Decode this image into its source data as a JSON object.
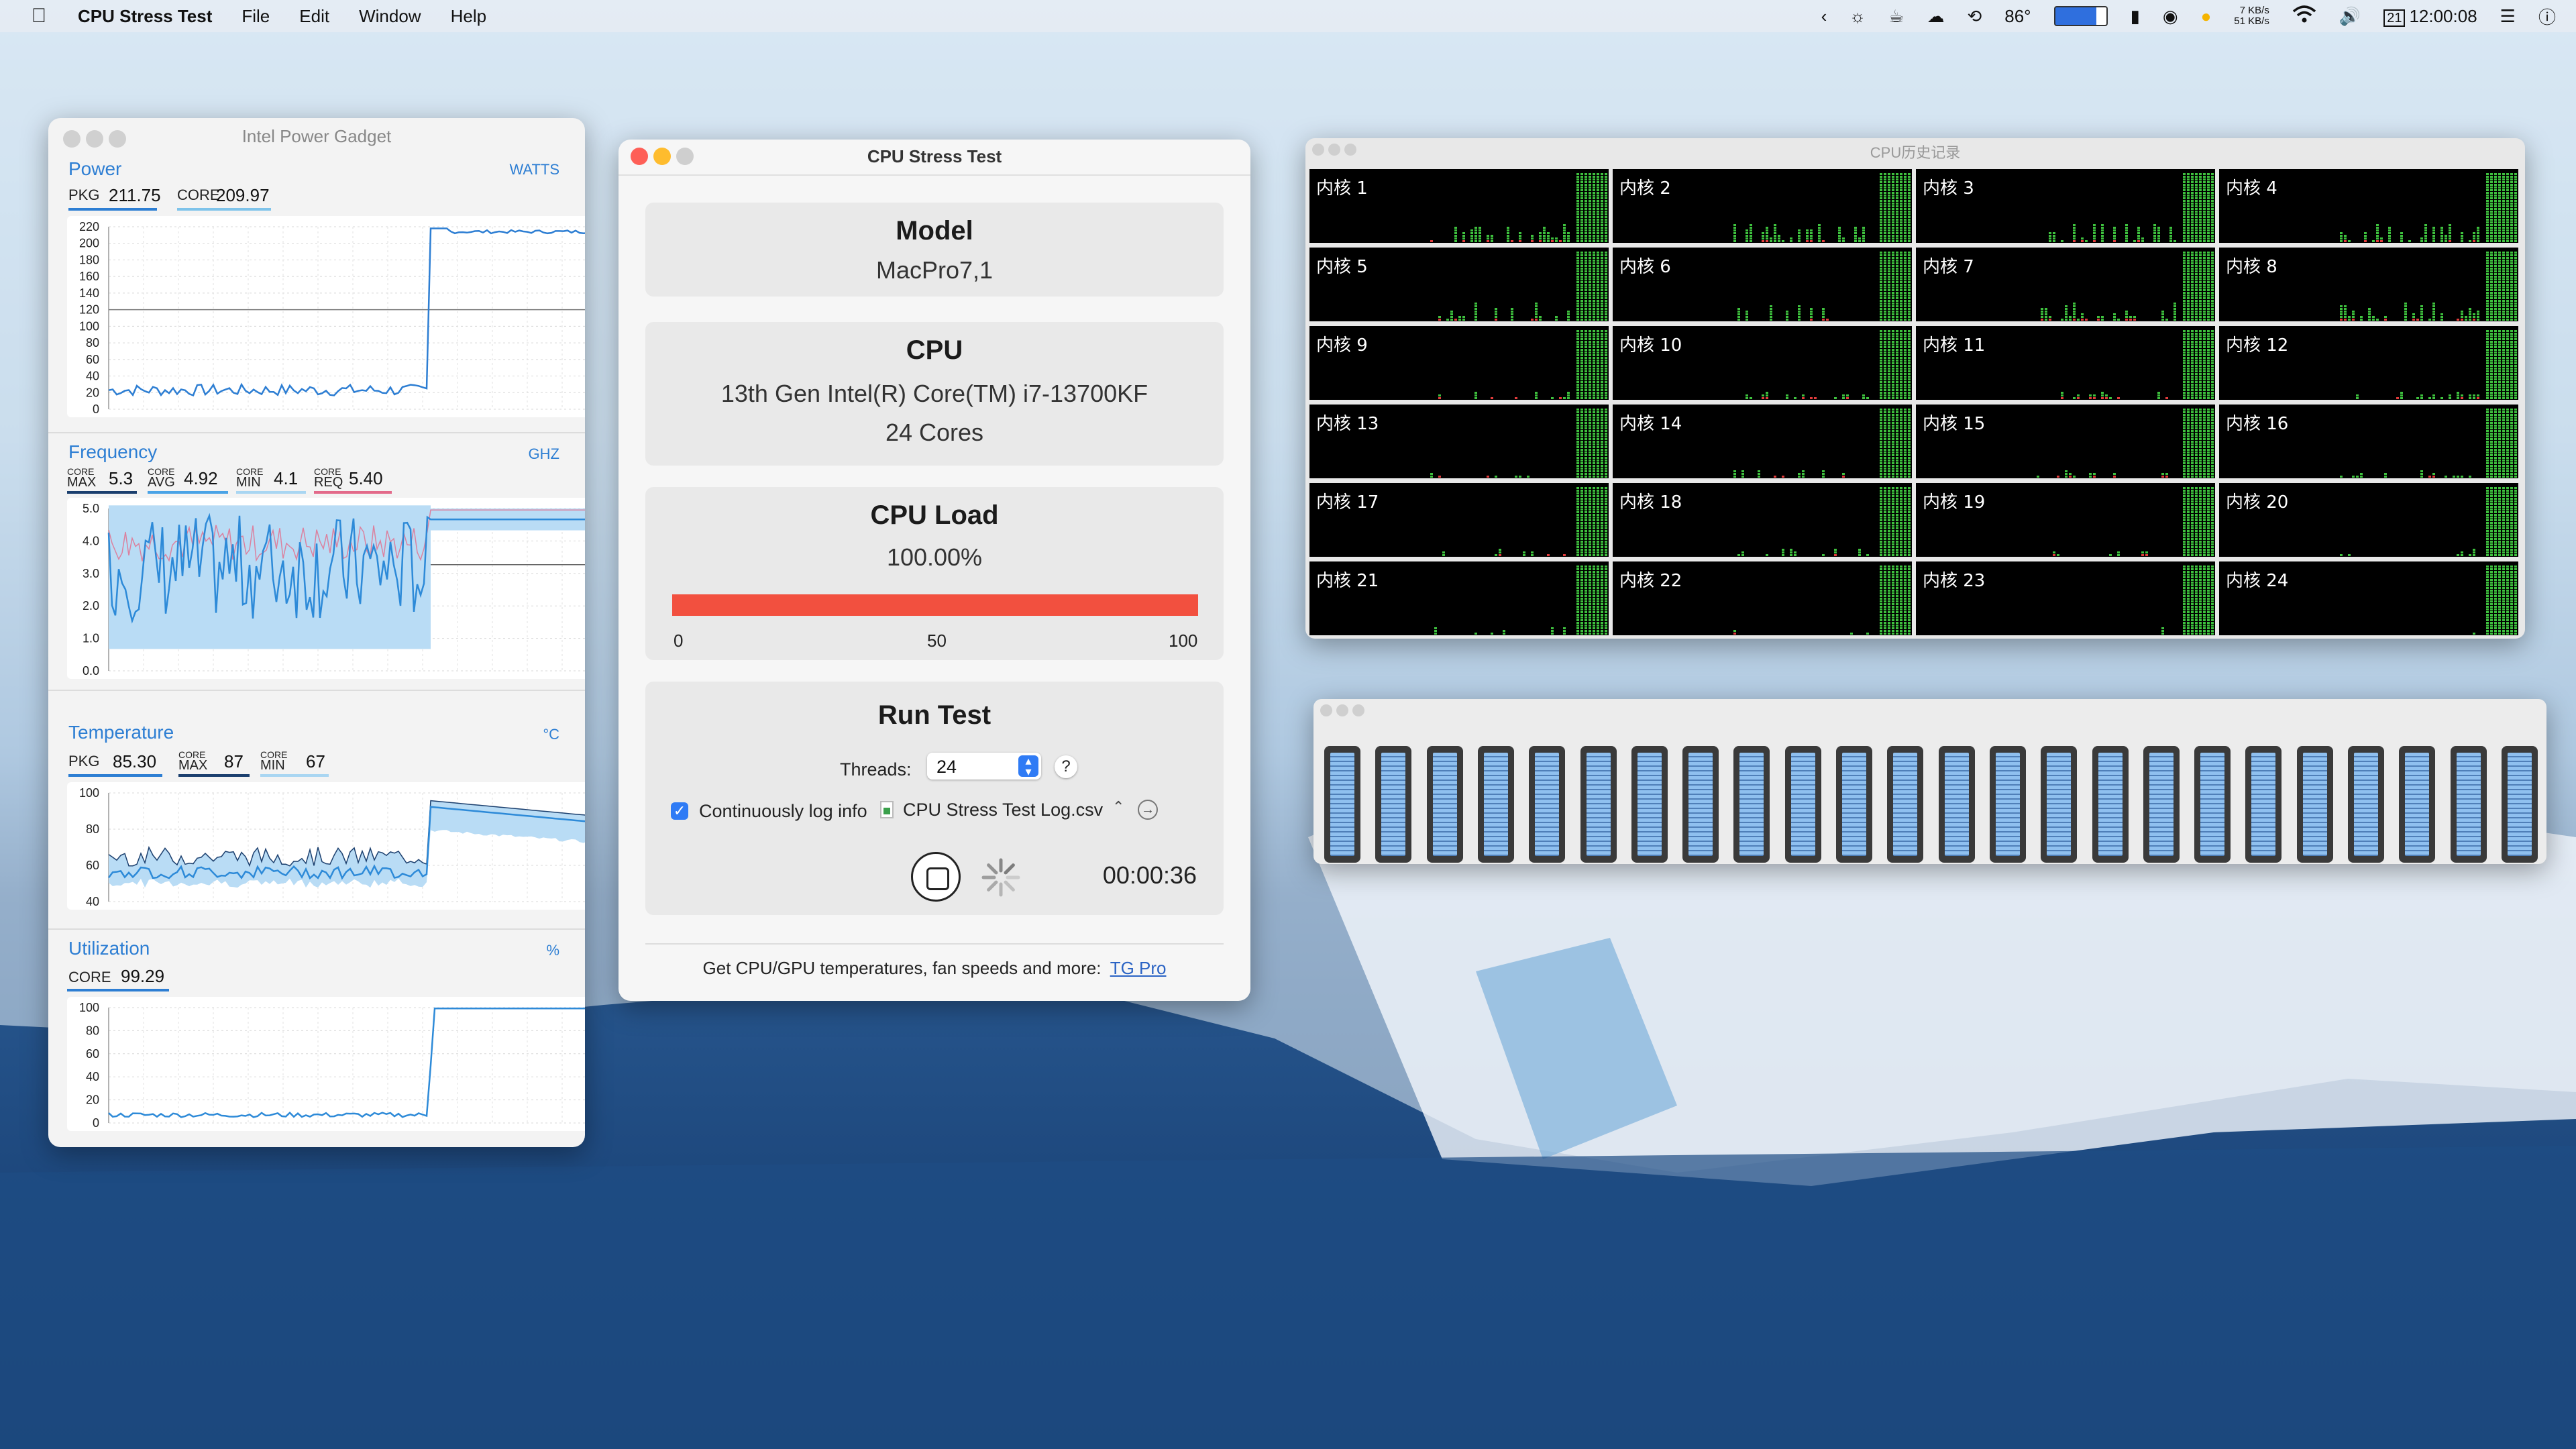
{
  "menubar": {
    "app_name": "CPU Stress Test",
    "menus": [
      "File",
      "Edit",
      "Window",
      "Help"
    ],
    "temperature": "86°",
    "net_up": "7 KB/s",
    "net_down": "51 KB/s",
    "date_day": "21",
    "clock": "12:00:08"
  },
  "power_gadget": {
    "title": "Intel Power Gadget",
    "power": {
      "title": "Power",
      "unit": "WATTS",
      "pkg_label": "PKG",
      "pkg_value": "211.75",
      "core_label": "CORE",
      "core_value": "209.97",
      "y_ticks": [
        "220",
        "200",
        "180",
        "160",
        "140",
        "120",
        "100",
        "80",
        "60",
        "40",
        "20",
        "0"
      ]
    },
    "frequency": {
      "title": "Frequency",
      "unit": "GHZ",
      "stats": [
        {
          "top": "CORE",
          "bottom": "MAX",
          "value": "5.3"
        },
        {
          "top": "CORE",
          "bottom": "AVG",
          "value": "4.92"
        },
        {
          "top": "CORE",
          "bottom": "MIN",
          "value": "4.1"
        },
        {
          "top": "CORE",
          "bottom": "REQ",
          "value": "5.40"
        }
      ],
      "y_ticks": [
        "5.0",
        "4.0",
        "3.0",
        "2.0",
        "1.0",
        "0.0"
      ]
    },
    "temperature": {
      "title": "Temperature",
      "unit": "°C",
      "pkg_label": "PKG",
      "pkg_value": "85.30",
      "max_top": "CORE",
      "max_bottom": "MAX",
      "max_value": "87",
      "min_top": "CORE",
      "min_bottom": "MIN",
      "min_value": "67",
      "y_ticks": [
        "100",
        "80",
        "60",
        "40"
      ]
    },
    "utilization": {
      "title": "Utilization",
      "unit": "%",
      "core_label": "CORE",
      "core_value": "99.29",
      "y_ticks": [
        "100",
        "80",
        "60",
        "40",
        "20",
        "0"
      ]
    }
  },
  "stress_test": {
    "title": "CPU Stress Test",
    "model_heading": "Model",
    "model_value": "MacPro7,1",
    "cpu_heading": "CPU",
    "cpu_name": "13th Gen Intel(R) Core(TM) i7-13700KF",
    "cpu_cores": "24 Cores",
    "load_heading": "CPU Load",
    "load_value": "100.00%",
    "load_fraction": 1.0,
    "load_ticks": [
      "0",
      "50",
      "100"
    ],
    "run_heading": "Run Test",
    "threads_label": "Threads:",
    "threads_value": "24",
    "help_label": "?",
    "log_checkbox_label": "Continuously log info",
    "log_file": "CPU Stress Test Log.csv",
    "elapsed": "00:00:36",
    "footer_text": "Get CPU/GPU temperatures, fan speeds and more:",
    "footer_link": "TG Pro",
    "accent_color": "#f2503f"
  },
  "cpu_history": {
    "title": "CPU历史记录",
    "cores": [
      "内核 1",
      "内核 2",
      "内核 3",
      "内核 4",
      "内核 5",
      "内核 6",
      "内核 7",
      "内核 8",
      "内核 9",
      "内核 10",
      "内核 11",
      "内核 12",
      "内核 13",
      "内核 14",
      "内核 15",
      "内核 16",
      "内核 17",
      "内核 18",
      "内核 19",
      "内核 20",
      "内核 21",
      "内核 22",
      "内核 23",
      "内核 24"
    ]
  },
  "core_meters": {
    "count": 24,
    "levels": [
      1,
      1,
      1,
      1,
      1,
      1,
      1,
      1,
      1,
      1,
      1,
      1,
      1,
      1,
      1,
      1,
      1,
      1,
      1,
      1,
      1,
      1,
      1,
      1
    ]
  }
}
